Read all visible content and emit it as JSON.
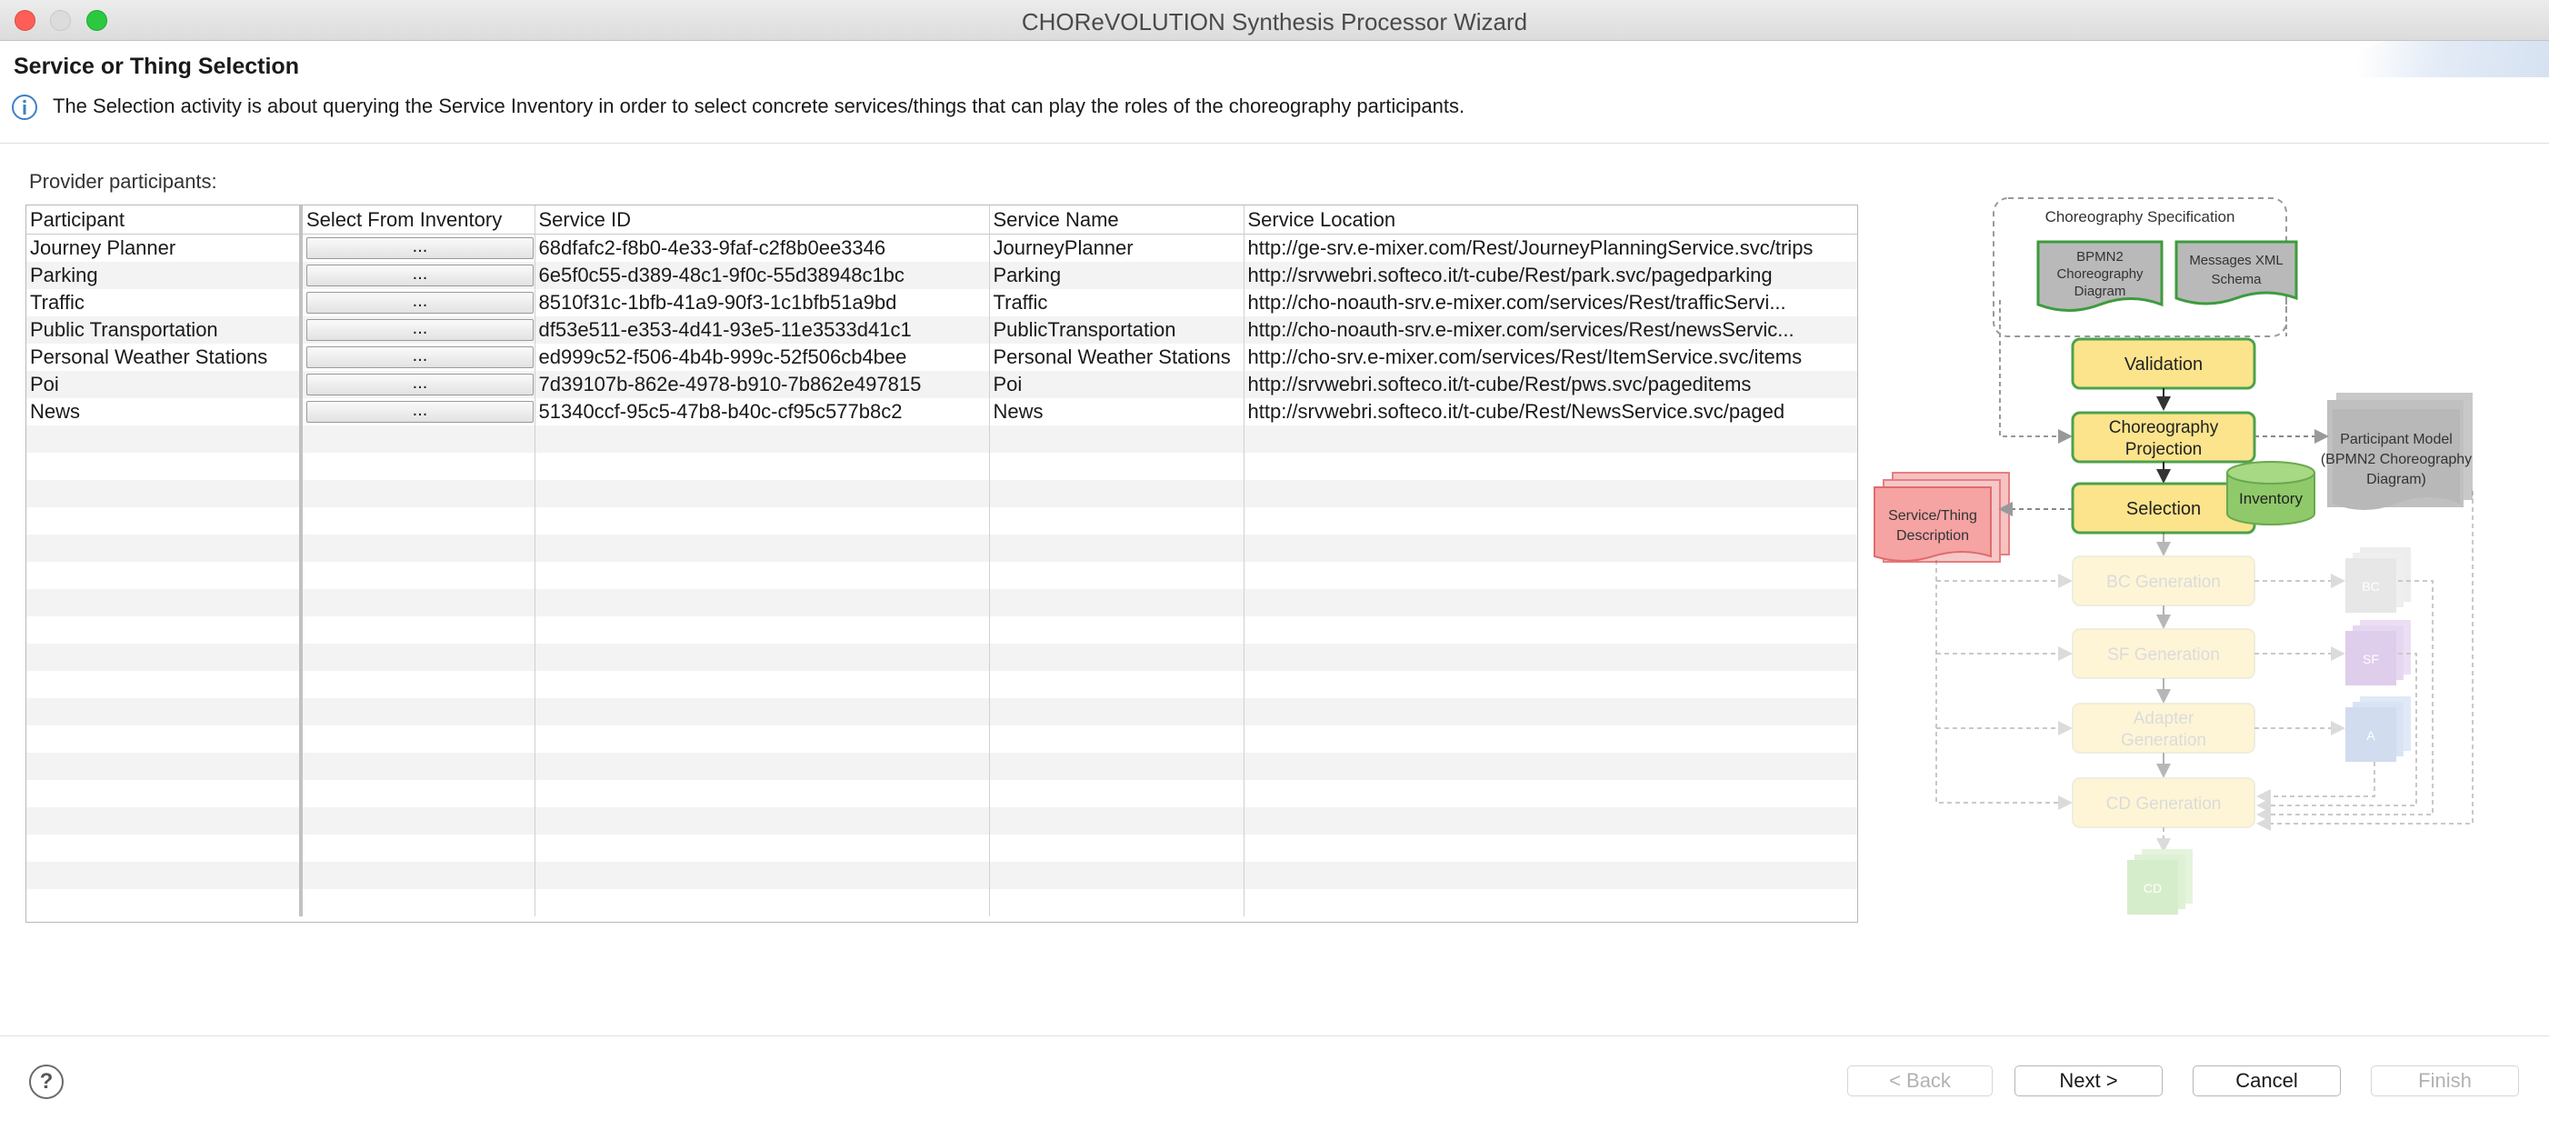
{
  "window": {
    "title": "CHOReVOLUTION Synthesis Processor Wizard"
  },
  "header": {
    "page_title": "Service or Thing Selection",
    "description": "The Selection activity is about querying the Service Inventory in order to select concrete services/things that can play the roles of the choreography participants."
  },
  "table": {
    "section_label": "Provider participants:",
    "columns": [
      "Participant",
      "Select From Inventory",
      "Service ID",
      "Service Name",
      "Service Location"
    ],
    "button_label": "...",
    "rows": [
      {
        "participant": "Journey Planner",
        "service_id": "68dfafc2-f8b0-4e33-9faf-c2f8b0ee3346",
        "service_name": "JourneyPlanner",
        "service_location": "http://ge-srv.e-mixer.com/Rest/JourneyPlanningService.svc/trips"
      },
      {
        "participant": "Parking",
        "service_id": "6e5f0c55-d389-48c1-9f0c-55d38948c1bc",
        "service_name": "Parking",
        "service_location": "http://srvwebri.softeco.it/t-cube/Rest/park.svc/pagedparking"
      },
      {
        "participant": "Traffic",
        "service_id": "8510f31c-1bfb-41a9-90f3-1c1bfb51a9bd",
        "service_name": "Traffic",
        "service_location": "http://cho-noauth-srv.e-mixer.com/services/Rest/trafficServi..."
      },
      {
        "participant": "Public Transportation",
        "service_id": "df53e511-e353-4d41-93e5-11e3533d41c1",
        "service_name": "PublicTransportation",
        "service_location": "http://cho-noauth-srv.e-mixer.com/services/Rest/newsServic..."
      },
      {
        "participant": "Personal Weather Stations",
        "service_id": "ed999c52-f506-4b4b-999c-52f506cb4bee",
        "service_name": "Personal Weather Stations",
        "service_location": "http://cho-srv.e-mixer.com/services/Rest/ItemService.svc/items"
      },
      {
        "participant": "Poi",
        "service_id": "7d39107b-862e-4978-b910-7b862e497815",
        "service_name": "Poi",
        "service_location": "http://srvwebri.softeco.it/t-cube/Rest/pws.svc/pageditems"
      },
      {
        "participant": "News",
        "service_id": "51340ccf-95c5-47b8-b40c-cf95c577b8c2",
        "service_name": "News",
        "service_location": "http://srvwebri.softeco.it/t-cube/Rest/NewsService.svc/paged"
      }
    ]
  },
  "diagram": {
    "spec_title": "Choreography Specification",
    "bpmn_doc": [
      "BPMN2",
      "Choreography",
      "Diagram"
    ],
    "xml_doc": [
      "Messages XML",
      "Schema"
    ],
    "validation": "Validation",
    "projection": [
      "Choreography",
      "Projection"
    ],
    "selection": "Selection",
    "inventory": "Inventory",
    "participant_model": [
      "Participant Model",
      "(BPMN2 Choreography",
      "Diagram)"
    ],
    "service_desc": [
      "Service/Thing",
      "Description"
    ],
    "bc_generation": "BC Generation",
    "sf_generation": "SF Generation",
    "adapter_generation": [
      "Adapter",
      "Generation"
    ],
    "cd_generation": "CD Generation",
    "bc_doc": "BC",
    "sf_doc": "SF",
    "adapter_doc": "A",
    "cd_doc": "CD"
  },
  "footer": {
    "help_label": "?",
    "back_label": "< Back",
    "next_label": "Next >",
    "cancel_label": "Cancel",
    "finish_label": "Finish"
  }
}
